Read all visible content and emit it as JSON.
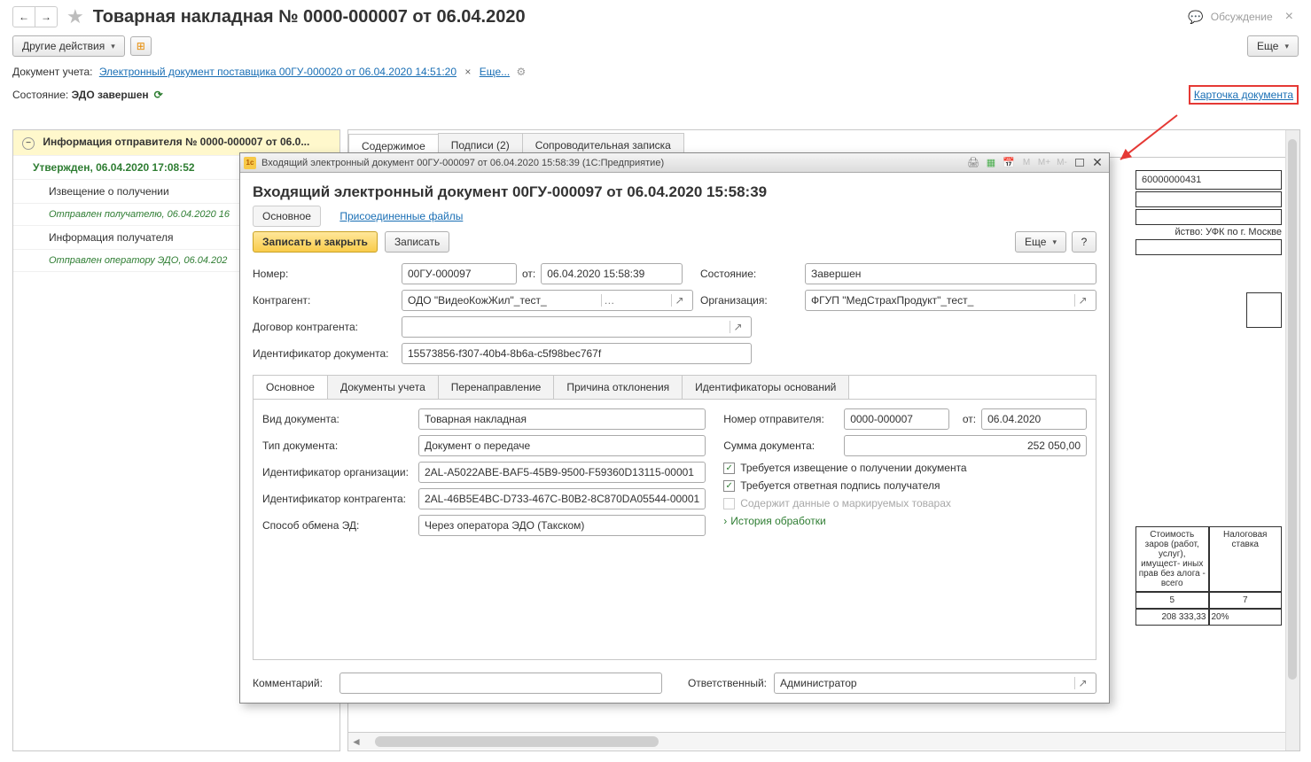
{
  "header": {
    "title": "Товарная накладная № 0000-000007 от 06.04.2020",
    "discussion": "Обсуждение"
  },
  "toolbar": {
    "other_actions": "Другие действия",
    "more": "Еще"
  },
  "doc_link_row": {
    "label": "Документ учета:",
    "link_text": "Электронный документ поставщика 00ГУ-000020 от 06.04.2020 14:51:20",
    "more_link": "Еще..."
  },
  "status_row": {
    "label": "Состояние:",
    "value": "ЭДО завершен",
    "card_link": "Карточка документа"
  },
  "tree": {
    "header": "Информация отправителя № 0000-000007 от 06.0...",
    "approved": "Утвержден, 06.04.2020 17:08:52",
    "notice": "Извещение о получении",
    "note1": "Отправлен получателю, 06.04.2020 16",
    "recipient_info": "Информация получателя",
    "note2": "Отправлен оператору ЭДО, 06.04.202"
  },
  "tabs": {
    "content": "Содержимое",
    "signatures": "Подписи (2)",
    "cover_note": "Сопроводительная записка"
  },
  "background": {
    "code1": "60000000431",
    "treasury": "йство: УФК по г. Москве",
    "col_head_cost": "Стоимость заров (работ, услуг), имущест- иных прав без алога - всего",
    "col_head_rate": "Налоговая ставка",
    "col_num_5": "5",
    "col_num_7": "7",
    "val_5": "208 333,33",
    "val_7": "20%"
  },
  "modal": {
    "titlebar": "Входящий электронный документ 00ГУ-000097 от 06.04.2020 15:58:39  (1С:Предприятие)",
    "heading": "Входящий электронный документ 00ГУ-000097 от 06.04.2020 15:58:39",
    "nav_main": "Основное",
    "nav_files": "Присоединенные файлы",
    "write_close": "Записать и закрыть",
    "write": "Записать",
    "more": "Еще",
    "help": "?",
    "labels": {
      "number": "Номер:",
      "from": "от:",
      "state": "Состояние:",
      "counterparty": "Контрагент:",
      "organization": "Организация:",
      "contract": "Договор контрагента:",
      "doc_id": "Идентификатор документа:",
      "doc_kind": "Вид документа:",
      "doc_type": "Тип документа:",
      "org_id": "Идентификатор организации:",
      "cparty_id": "Идентификатор контрагента:",
      "exchange": "Способ обмена ЭД:",
      "sender_no": "Номер отправителя:",
      "sum": "Сумма документа:",
      "chk_notice": "Требуется извещение о получении документа",
      "chk_sig": "Требуется ответная подпись получателя",
      "chk_mark": "Содержит данные о маркируемых товарах",
      "history": "История обработки",
      "comment": "Комментарий:",
      "responsible": "Ответственный:"
    },
    "values": {
      "number": "00ГУ-000097",
      "from": "06.04.2020 15:58:39",
      "state": "Завершен",
      "counterparty": "ОДО \"ВидеоКожЖил\"_тест_",
      "organization": "ФГУП \"МедСтрахПродукт\"_тест_",
      "contract": "",
      "doc_id": "15573856-f307-40b4-8b6a-c5f98bec767f",
      "doc_kind": "Товарная накладная",
      "doc_type": "Документ о передаче",
      "org_id": "2AL-A5022ABE-BAF5-45B9-9500-F59360D13115-00001",
      "cparty_id": "2AL-46B5E4BC-D733-467C-B0B2-8C870DA05544-00001",
      "exchange": "Через оператора ЭДО (Такском)",
      "sender_no": "0000-000007",
      "sender_from": "06.04.2020",
      "sum": "252 050,00",
      "responsible": "Администратор"
    },
    "inner_tabs": {
      "main": "Основное",
      "ledger": "Документы учета",
      "redirect": "Перенаправление",
      "reject": "Причина отклонения",
      "ids": "Идентификаторы оснований"
    }
  }
}
